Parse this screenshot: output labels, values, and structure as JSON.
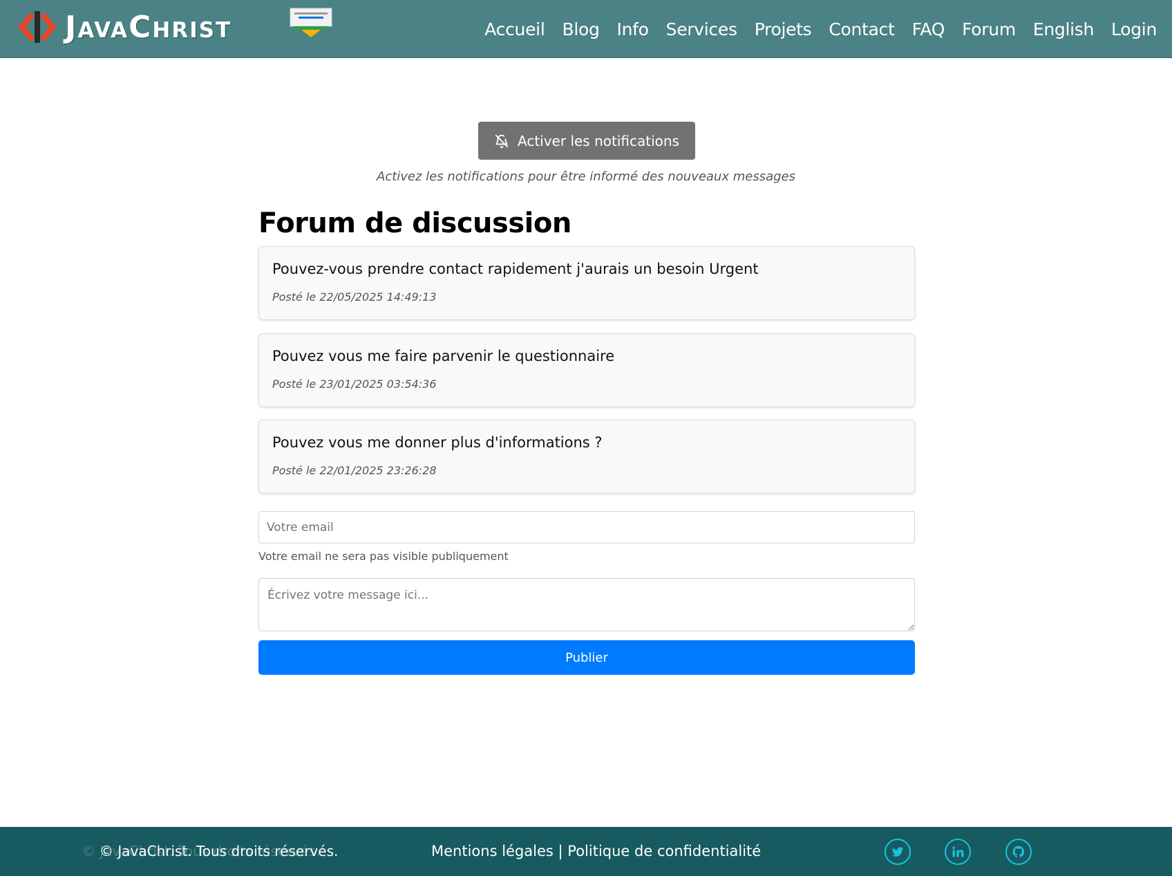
{
  "header": {
    "brand": "JavaChrist",
    "nav": [
      "Accueil",
      "Blog",
      "Info",
      "Services",
      "Projets",
      "Contact",
      "FAQ",
      "Forum",
      "English",
      "Login"
    ]
  },
  "notifications": {
    "button_label": "Activer les notifications",
    "hint": "Activez les notifications pour être informé des nouveaux messages"
  },
  "forum": {
    "title": "Forum de discussion",
    "posts": [
      {
        "message": "Pouvez-vous prendre contact rapidement j'aurais un besoin Urgent",
        "date": "Posté le 22/05/2025 14:49:13"
      },
      {
        "message": "Pouvez vous me faire parvenir le questionnaire",
        "date": "Posté le 23/01/2025 03:54:36"
      },
      {
        "message": "Pouvez vous me donner plus d'informations ?",
        "date": "Posté le 22/01/2025 23:26:28"
      }
    ]
  },
  "form": {
    "email_placeholder": "Votre email",
    "email_help": "Votre email ne sera pas visible publiquement",
    "message_placeholder": "Écrivez votre message ici...",
    "submit_label": "Publier"
  },
  "footer": {
    "copyright": "© JavaChrist. Tous droits réservés.",
    "legal_link": "Mentions légales",
    "separator": "|",
    "privacy_link": "Politique de confidentialité",
    "social": [
      "twitter-icon",
      "linkedin-icon",
      "github-icon"
    ]
  },
  "colors": {
    "header_bg": "#4a8285",
    "footer_bg": "#175a60",
    "primary": "#007bff",
    "notif_button": "#727272",
    "social_accent": "#17c3e0"
  }
}
